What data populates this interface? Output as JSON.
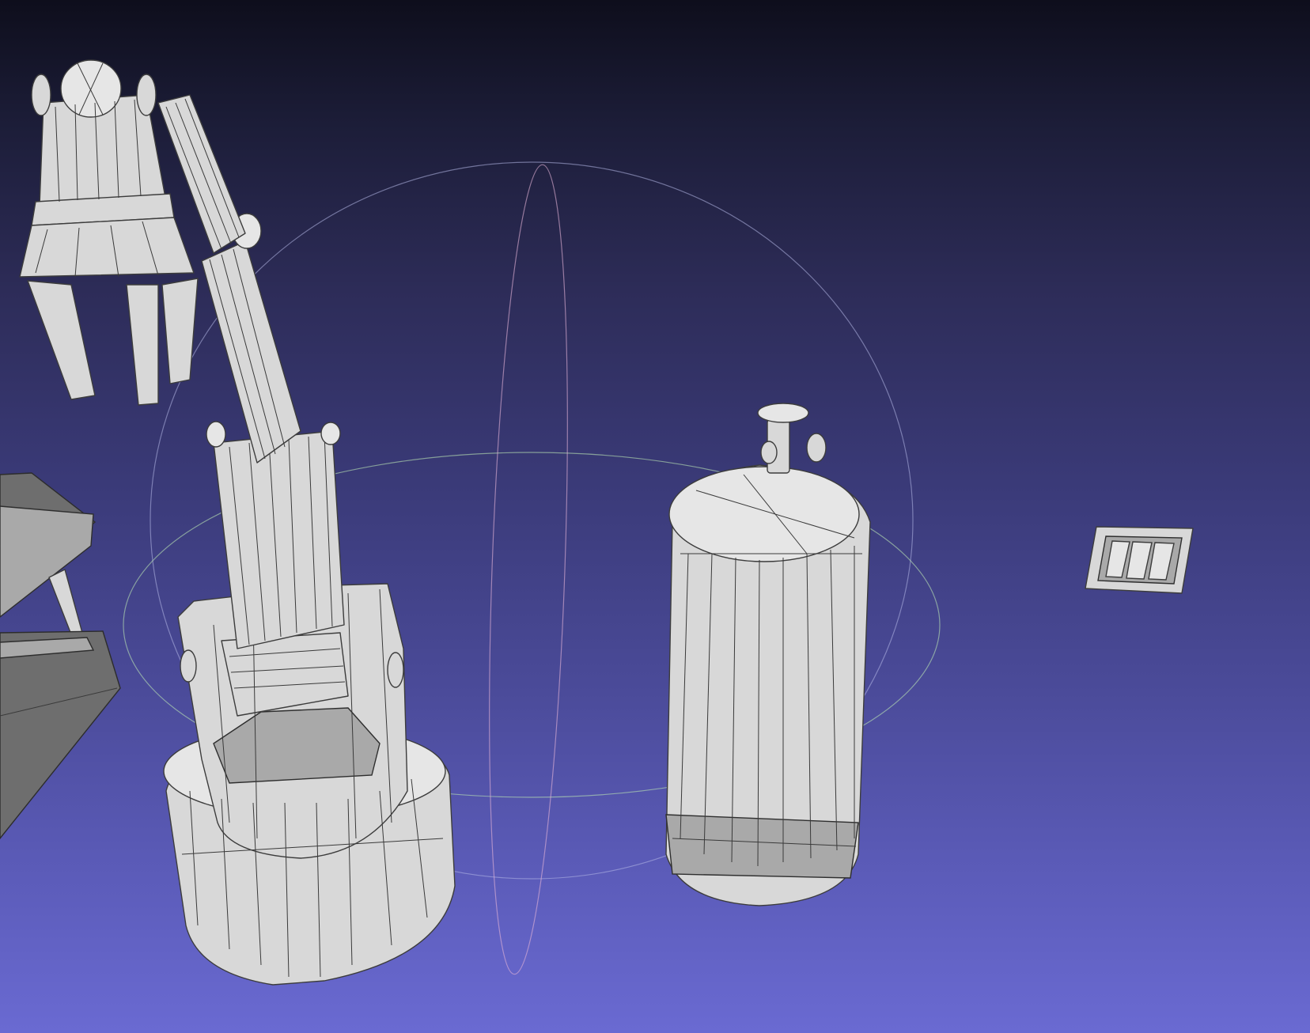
{
  "viewer": {
    "background_top": "#0e0e1c",
    "background_bottom": "#6a6ad2",
    "mesh_color": "#d8d8d8",
    "wire_color": "#3a3a3a",
    "trackball": {
      "horizontal_ring_color": "#b9e3b3",
      "vertical_ring_color": "#e3b3d6",
      "depth_ring_color": "#b5b8e6"
    }
  },
  "scene_objects": [
    {
      "name": "robotic-arm",
      "icon": "robot-arm-icon"
    },
    {
      "name": "gas-cylinder",
      "icon": "cylinder-icon"
    },
    {
      "name": "wall-switch-plate",
      "icon": "switch-icon"
    },
    {
      "name": "workbench",
      "icon": "table-icon"
    }
  ]
}
